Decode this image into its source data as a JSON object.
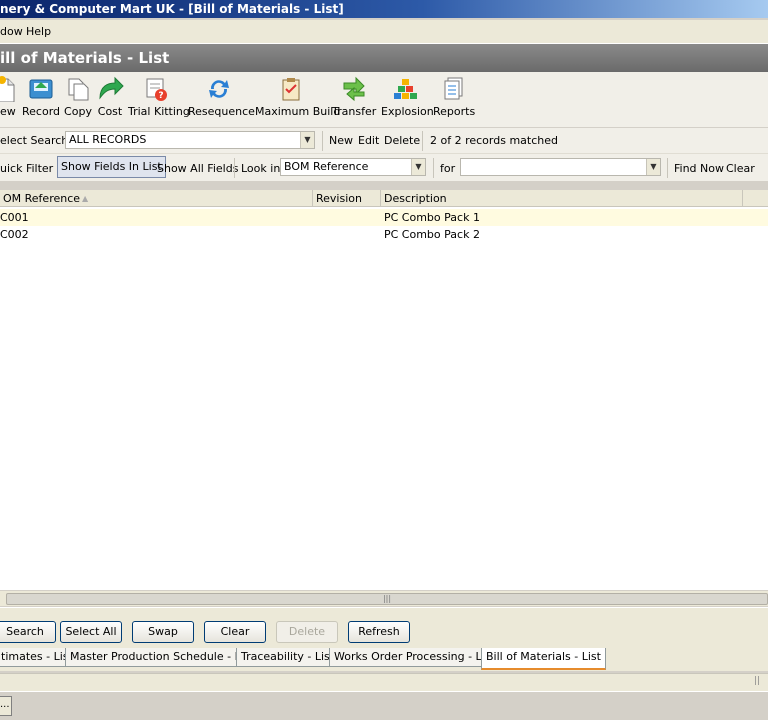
{
  "window": {
    "title": "nery & Computer Mart UK - [Bill of Materials - List]"
  },
  "menu": {
    "items": [
      "dow",
      "Help"
    ]
  },
  "header": {
    "title": "ill of Materials - List"
  },
  "toolbar": {
    "buttons": [
      {
        "label": "ew",
        "icon": "new-document-icon"
      },
      {
        "label": "Record",
        "icon": "record-icon"
      },
      {
        "label": "Copy",
        "icon": "copy-icon"
      },
      {
        "label": "Cost",
        "icon": "cost-arrow-icon"
      },
      {
        "label": "Trial Kitting",
        "icon": "trial-kitting-icon"
      },
      {
        "label": "Resequence",
        "icon": "resequence-icon"
      },
      {
        "label": "Maximum Build",
        "icon": "maximum-build-icon"
      },
      {
        "label": "Transfer",
        "icon": "transfer-icon"
      },
      {
        "label": "Explosion",
        "icon": "explosion-icon"
      },
      {
        "label": "Reports",
        "icon": "reports-icon"
      }
    ]
  },
  "search": {
    "label": "elect Search",
    "value": "ALL RECORDS",
    "new_label": "New",
    "edit_label": "Edit",
    "delete_label": "Delete",
    "status": "2 of 2 records matched"
  },
  "filter": {
    "quick_filter": "uick Filter",
    "show_fields": "Show Fields In List",
    "show_all": "Show All Fields",
    "look_in_label": "Look in",
    "look_in_value": "BOM Reference",
    "for_label": "for",
    "for_value": "",
    "find_now": "Find Now",
    "clear": "Clear"
  },
  "grid": {
    "columns": [
      "OM Reference",
      "Revision",
      "Description"
    ],
    "rows": [
      {
        "ref": "C001",
        "revision": "",
        "description": "PC Combo Pack 1"
      },
      {
        "ref": "C002",
        "revision": "",
        "description": "PC Combo Pack 2"
      }
    ]
  },
  "buttons": {
    "search": "Search",
    "select_all": "Select All",
    "swap": "Swap",
    "clear": "Clear",
    "delete": "Delete",
    "refresh": "Refresh"
  },
  "tabs": [
    "timates - List",
    "Master Production Schedule - List",
    "Traceability - List",
    "Works Order Processing - List",
    "Bill of Materials - List"
  ],
  "taskbar": {
    "button": "..."
  }
}
